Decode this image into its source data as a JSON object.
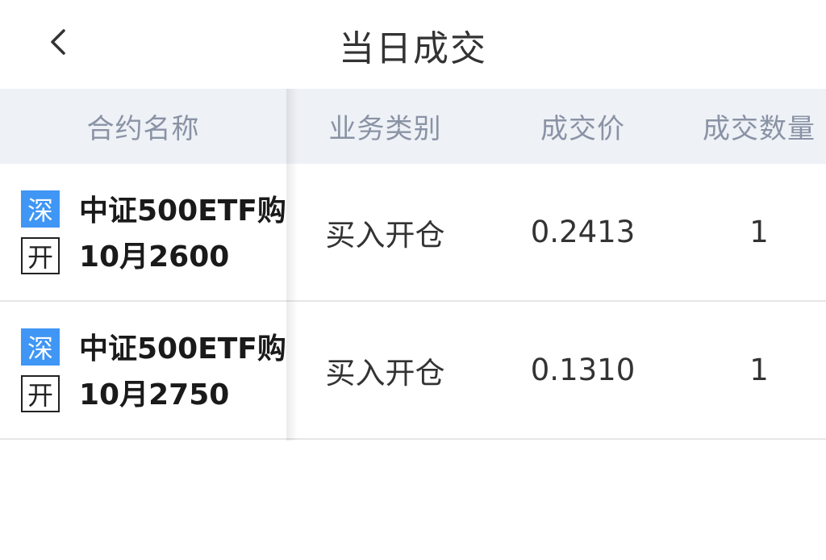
{
  "header": {
    "title": "当日成交",
    "back_icon": "chevron-left-icon"
  },
  "table": {
    "columns": [
      "合约名称",
      "业务类别",
      "成交价",
      "成交数量"
    ],
    "rows": [
      {
        "exchange_tag": "深",
        "action_tag": "开",
        "name_line1": "中证500ETF购",
        "name_line2": "10月2600",
        "business_type": "买入开仓",
        "price": "0.2413",
        "quantity": "1"
      },
      {
        "exchange_tag": "深",
        "action_tag": "开",
        "name_line1": "中证500ETF购",
        "name_line2": "10月2750",
        "business_type": "买入开仓",
        "price": "0.1310",
        "quantity": "1"
      }
    ]
  },
  "colors": {
    "header_bg": "#eef1f6",
    "header_text": "#8a93a5",
    "tag_blue": "#3f96f5"
  }
}
